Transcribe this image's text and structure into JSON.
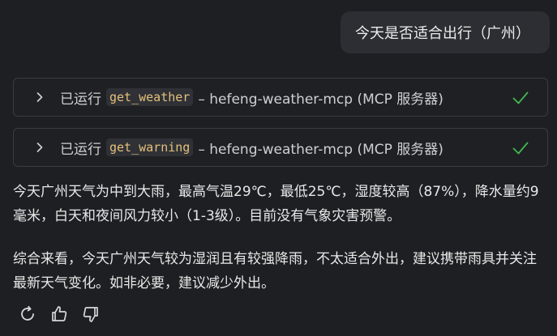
{
  "user_message": "今天是否适合出行（广州）",
  "tool_calls": [
    {
      "run_label": "已运行",
      "tool_name": "get_weather",
      "server": "– hefeng-weather-mcp (MCP 服务器)",
      "status_icon": "check-icon"
    },
    {
      "run_label": "已运行",
      "tool_name": "get_warning",
      "server": "– hefeng-weather-mcp (MCP 服务器)",
      "status_icon": "check-icon"
    }
  ],
  "answer": {
    "paragraph1": "今天广州天气为中到大雨，最高气温29℃，最低25℃，湿度较高（87%），降水量约9毫米，白天和夜间风力较小（1-3级）。目前没有气象灾害预警。",
    "paragraph2": "综合来看，今天广州天气较为湿润且有较强降雨，不太适合外出，建议携带雨具并关注最新天气变化。如非必要，建议减少外出。"
  },
  "actions": {
    "icons": [
      "regenerate-icon",
      "thumbs-up-icon",
      "thumbs-down-icon"
    ]
  },
  "colors": {
    "background": "#1e1f22",
    "user_bubble": "#2c2e33",
    "check": "#3fb950",
    "code": "#e5c07b"
  }
}
